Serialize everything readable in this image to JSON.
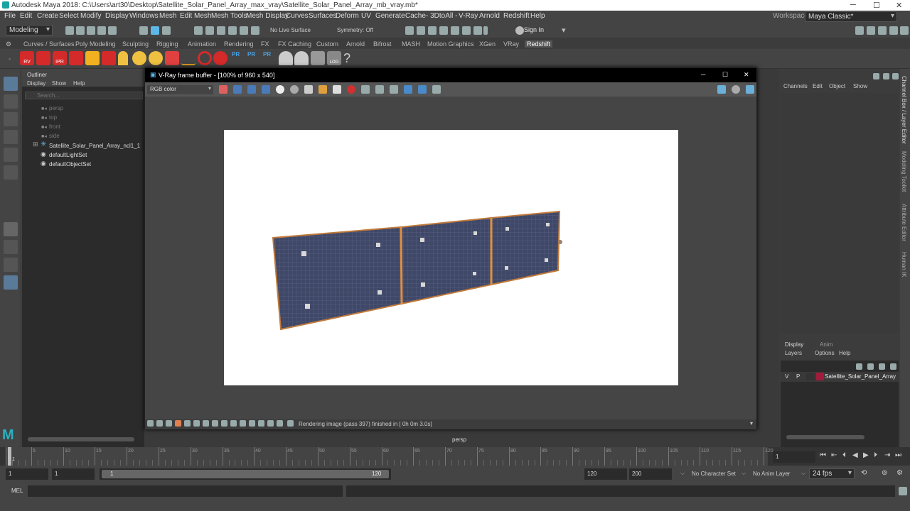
{
  "window": {
    "title": "Autodesk Maya 2018: C:\\Users\\art30\\Desktop\\Satellite_Solar_Panel_Array_max_vray\\Satellite_Solar_Panel_Array_mb_vray.mb*",
    "minimize": "─",
    "maximize": "☐",
    "close": "✕"
  },
  "menubar": {
    "items": [
      "File",
      "Edit",
      "Create",
      "Select",
      "Modify",
      "Display",
      "Windows",
      "Mesh",
      "Edit Mesh",
      "Mesh Tools",
      "Mesh Display",
      "Curves",
      "Surfaces",
      "Deform",
      "UV",
      "Generate",
      "Cache",
      "- 3DtoAll -",
      "V-Ray",
      "Arnold",
      "Redshift",
      "Help"
    ],
    "workspace_label": "Workspace :",
    "workspace_value": "Maya Classic*"
  },
  "statusline": {
    "mode": "Modeling",
    "live_surface": "No Live Surface",
    "symmetry": "Symmetry: Off",
    "sign_in": "Sign In"
  },
  "shelf": {
    "tabs": [
      "Curves / Surfaces",
      "Poly Modeling",
      "Sculpting",
      "Rigging",
      "Animation",
      "Rendering",
      "FX",
      "FX Caching",
      "Custom",
      "Arnold",
      "Bifrost",
      "MASH",
      "Motion Graphics",
      "XGen",
      "VRay",
      "Redshift"
    ],
    "active_tab": "Redshift",
    "icon_labels": {
      "rv": "RV",
      "ipr": "IPR",
      "pr": "PR",
      "log": "LOG",
      "help": "?"
    }
  },
  "outliner": {
    "title": "Outliner",
    "menus": [
      "Display",
      "Show",
      "Help"
    ],
    "search_placeholder": "Search...",
    "items": [
      "persp",
      "top",
      "front",
      "side",
      "Satellite_Solar_Panel_Array_ncl1_1",
      "defaultLightSet",
      "defaultObjectSet"
    ],
    "expand": "⊞"
  },
  "vfb": {
    "title": "V-Ray frame buffer - [100% of 960 x 540]",
    "channel": "RGB color",
    "status": "Rendering image (pass 397) finished in [ 0h  0m  3.0s]",
    "minimize": "─",
    "maximize": "☐",
    "close": "✕"
  },
  "viewport": {
    "camera": "persp"
  },
  "channelbox": {
    "menus": [
      "Channels",
      "Edit",
      "Object",
      "Show"
    ]
  },
  "layers": {
    "tabs": [
      "Display",
      "Anim"
    ],
    "menus": [
      "Layers",
      "Options",
      "Help"
    ],
    "layer": {
      "v": "V",
      "p": "P",
      "name": "Satellite_Solar_Panel_Array",
      "color": "#a01c3c"
    }
  },
  "side_tabs": [
    "Channel Box / Layer Editor",
    "Modeling Toolkit",
    "Attribute Editor",
    "Human IK"
  ],
  "timeline": {
    "ticks": [
      "1",
      "5",
      "10",
      "15",
      "20",
      "25",
      "30",
      "35",
      "40",
      "45",
      "50",
      "55",
      "60",
      "65",
      "70",
      "75",
      "80",
      "85",
      "90",
      "95",
      "100",
      "105",
      "110",
      "115",
      "120"
    ],
    "current_frame": "1",
    "current_field": "1"
  },
  "range": {
    "start": "1",
    "anim_start": "1",
    "slider_start": "1",
    "slider_end": "120",
    "end": "120",
    "anim_end": "200",
    "character_set": "No Character Set",
    "anim_layer": "No Anim Layer",
    "fps": "24 fps"
  },
  "command": {
    "label": "MEL"
  },
  "colors": {
    "accent": "#5db8e8",
    "panel_frame": "#c07a3a",
    "panel_cell": "#3f4766"
  }
}
